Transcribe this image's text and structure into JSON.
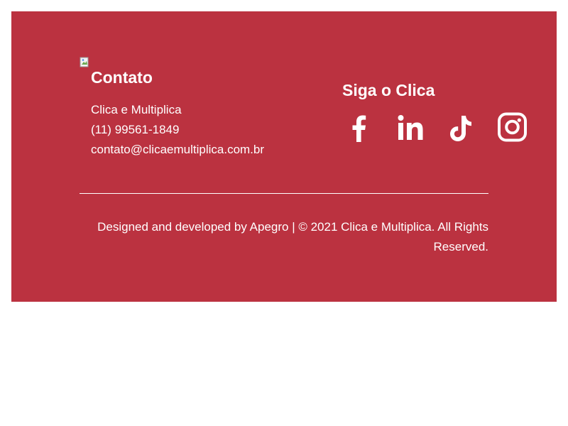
{
  "contact": {
    "title": "Contato",
    "name": "Clica e Multiplica",
    "phone": "(11) 99561-1849",
    "email": "contato@clicaemultiplica.com.br"
  },
  "social": {
    "title": "Siga o Clica",
    "icons": [
      "facebook-icon",
      "linkedin-icon",
      "tiktok-icon",
      "instagram-icon"
    ]
  },
  "credits": {
    "text": "Designed and developed by Apegro | © 2021 Clica e Multiplica. All Rights Reserved."
  },
  "colors": {
    "footer_bg": "#bb3240",
    "text": "#ffffff",
    "page_bg": "#ffffff"
  }
}
